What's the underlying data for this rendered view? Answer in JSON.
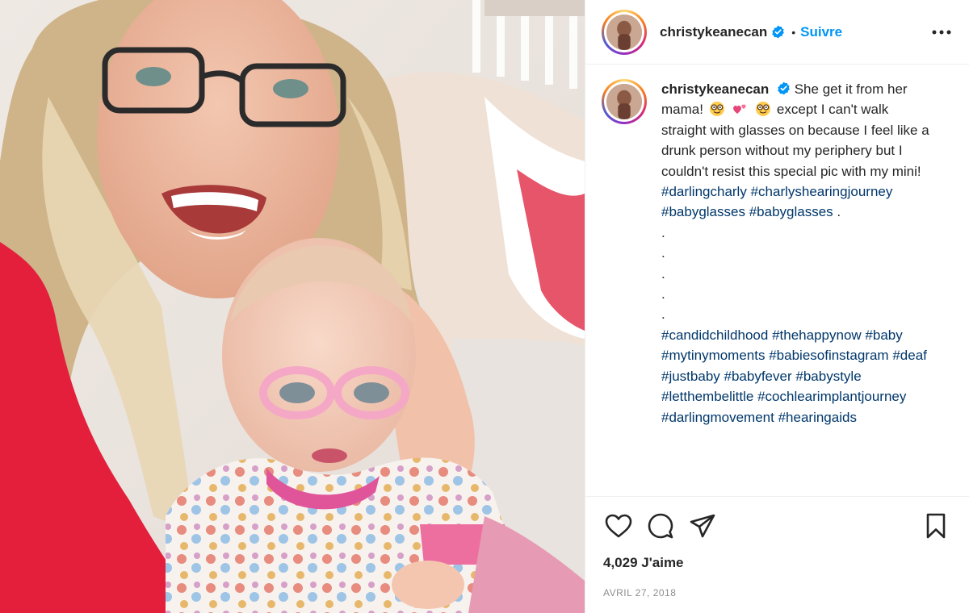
{
  "post": {
    "username": "christykeanecan",
    "follow_label": "Suivre",
    "separator": "•",
    "caption": {
      "username": "christykeanecan",
      "text_1": "She get it from her mama!",
      "text_2": "except I can't walk straight with glasses on because I feel like a drunk person without my periphery but I couldn't resist this special pic with my mini!",
      "tags_1": [
        "#darlingcharly",
        "#charlyshearingjourney",
        "#babyglasses",
        "#babyglasses"
      ],
      "tags_1_suffix": ".",
      "dots": [
        ".",
        ".",
        ".",
        ".",
        "."
      ],
      "tags_2": [
        "#candidchildhood",
        "#thehappynow",
        "#baby",
        "#mytinymoments",
        "#babiesofinstagram",
        "#deaf",
        "#justbaby",
        "#babyfever",
        "#babystyle",
        "#letthembelittle",
        "#cochlearimplantjourney",
        "#darlingmovement",
        "#hearingaids"
      ]
    },
    "likes": "4,029 J'aime",
    "date": "AVRIL 27, 2018"
  },
  "icons": {
    "more": "more-options-icon",
    "like": "heart-icon",
    "comment": "comment-icon",
    "share": "share-icon",
    "save": "bookmark-icon",
    "verified": "verified-badge-icon"
  },
  "colors": {
    "accent": "#0095f6",
    "hashtag": "#00376b",
    "muted": "#8e8e8e"
  }
}
